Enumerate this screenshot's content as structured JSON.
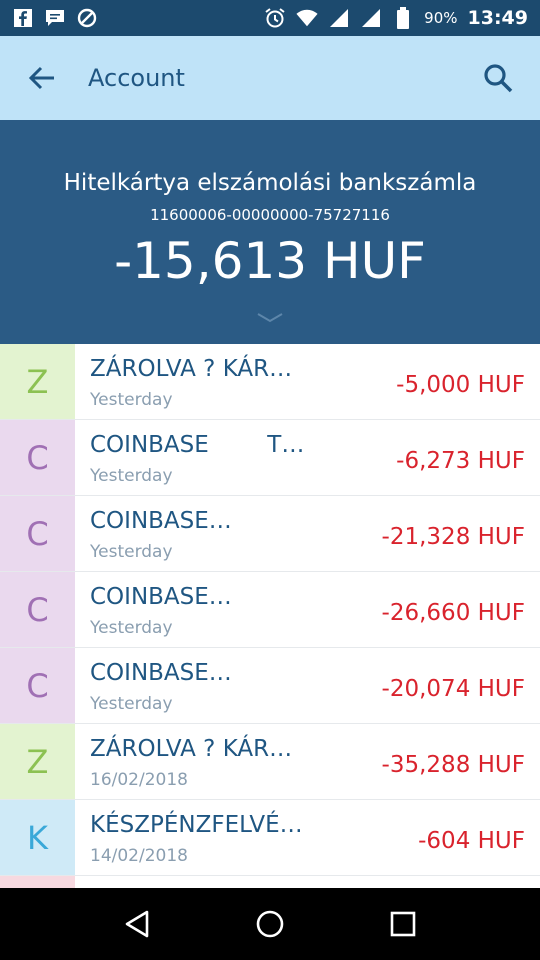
{
  "status_bar": {
    "battery": "90%",
    "time": "13:49",
    "icons": [
      "facebook-icon",
      "messages-icon",
      "blocked-icon",
      "alarm-icon",
      "wifi-icon",
      "signal-icon",
      "signal-icon",
      "battery-icon"
    ]
  },
  "app_bar": {
    "title": "Account"
  },
  "account": {
    "name": "Hitelkártya elszámolási bankszámla",
    "number": "11600006-00000000-75727116",
    "balance": "-15,613 HUF"
  },
  "transactions": [
    {
      "initial": "Z",
      "title": "ZÁROLVA ? KÁR…",
      "date": "Yesterday",
      "amount": "-5,000 HUF",
      "avatar_bg": "#e3f3d0",
      "avatar_fg": "#8cc152"
    },
    {
      "initial": "C",
      "title": "COINBASE        T…",
      "date": "Yesterday",
      "amount": "-6,273 HUF",
      "avatar_bg": "#ead9ee",
      "avatar_fg": "#a070b4"
    },
    {
      "initial": "C",
      "title": "COINBASE…",
      "date": "Yesterday",
      "amount": "-21,328 HUF",
      "avatar_bg": "#ead9ee",
      "avatar_fg": "#a070b4"
    },
    {
      "initial": "C",
      "title": "COINBASE…",
      "date": "Yesterday",
      "amount": "-26,660 HUF",
      "avatar_bg": "#ead9ee",
      "avatar_fg": "#a070b4"
    },
    {
      "initial": "C",
      "title": "COINBASE…",
      "date": "Yesterday",
      "amount": "-20,074 HUF",
      "avatar_bg": "#ead9ee",
      "avatar_fg": "#a070b4"
    },
    {
      "initial": "Z",
      "title": "ZÁROLVA ? KÁR…",
      "date": "16/02/2018",
      "amount": "-35,288 HUF",
      "avatar_bg": "#e3f3d0",
      "avatar_fg": "#8cc152"
    },
    {
      "initial": "K",
      "title": "KÉSZPÉNZFELVÉ…",
      "date": "14/02/2018",
      "amount": "-604 HUF",
      "avatar_bg": "#cfeaf7",
      "avatar_fg": "#3aa8d8"
    }
  ],
  "partial_row": {
    "avatar_bg": "#f7d9e0"
  },
  "colors": {
    "status_bar": "#1c4a6e",
    "app_bar": "#bfe3f8",
    "header": "#2b5b85",
    "amount_negative": "#d9232d"
  },
  "nav": [
    "back-icon",
    "home-icon",
    "recents-icon"
  ]
}
